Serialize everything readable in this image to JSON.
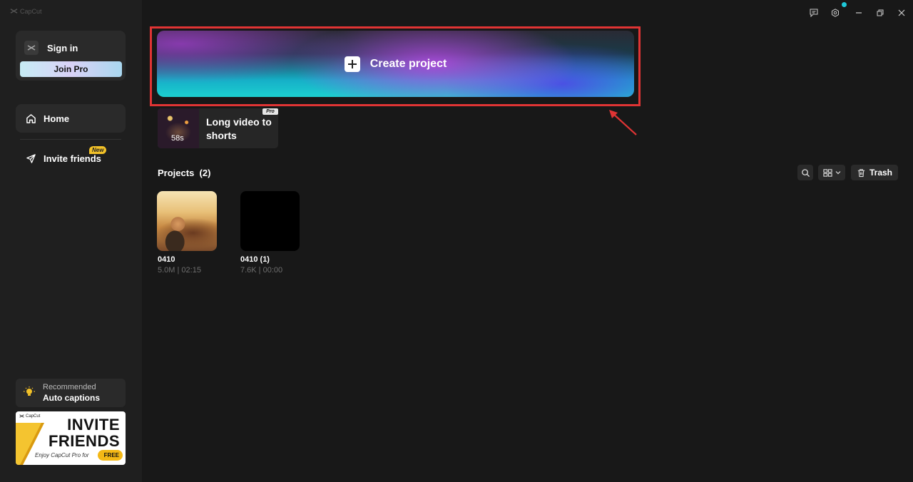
{
  "app": {
    "name": "CapCut"
  },
  "sidebar": {
    "signin_label": "Sign in",
    "join_pro_label": "Join Pro",
    "nav": [
      {
        "label": "Home",
        "icon": "home-icon"
      },
      {
        "label": "Invite friends",
        "icon": "send-icon",
        "badge": "New"
      }
    ],
    "recommended": {
      "small": "Recommended",
      "title": "Auto captions",
      "icon": "lightbulb-icon"
    },
    "promo": {
      "logo": "CapCut",
      "line1": "INVITE",
      "line2": "FRIENDS",
      "line3": "Enjoy CapCut Pro for",
      "badge": "FREE"
    }
  },
  "window_controls": [
    "feedback-icon",
    "settings-icon",
    "minimize-icon",
    "restore-icon",
    "close-icon"
  ],
  "main": {
    "create_project_label": "Create project",
    "long_video": {
      "line1": "Long video to",
      "line2": "shorts",
      "duration": "58s",
      "badge": "Pro"
    },
    "projects": {
      "title": "Projects",
      "count": "(2)",
      "trash_label": "Trash",
      "items": [
        {
          "name": "0410",
          "meta": "5.0M | 02:15"
        },
        {
          "name": "0410 (1)",
          "meta": "7.6K | 00:00"
        }
      ]
    }
  },
  "colors": {
    "highlight": "#e03434",
    "accent": "#1ec8d8",
    "new_badge": "#f2c128"
  }
}
